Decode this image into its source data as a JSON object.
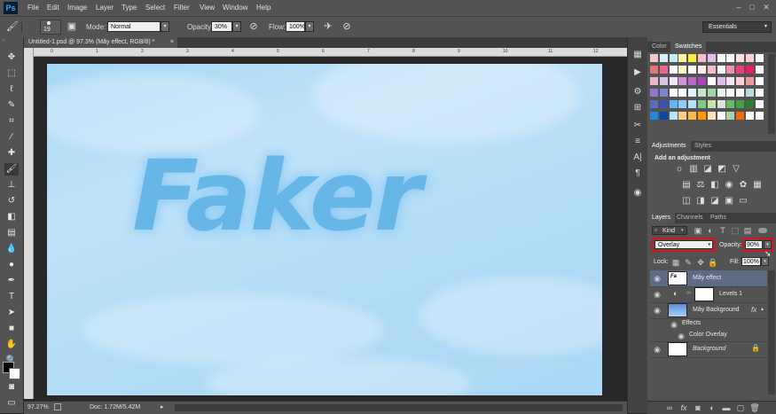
{
  "app": {
    "logo": "Ps"
  },
  "menu": [
    "File",
    "Edit",
    "Image",
    "Layer",
    "Type",
    "Select",
    "Filter",
    "View",
    "Window",
    "Help"
  ],
  "window_controls": {
    "minimize": "–",
    "maximize": "□",
    "close": "✕"
  },
  "options": {
    "brush_size": "19",
    "mode_label": "Mode:",
    "mode_value": "Normal",
    "opacity_label": "Opacity:",
    "opacity_value": "30%",
    "flow_label": "Flow:",
    "flow_value": "100%",
    "workspace": "Essentials"
  },
  "document": {
    "tab_title": "Untitled-1.psd @ 97.3% (Mây effect, RGB/8) *",
    "tab_close": "×",
    "canvas_text": "Faker",
    "ruler_top": [
      "0",
      "1",
      "2",
      "3",
      "4",
      "5",
      "6",
      "7",
      "8",
      "9",
      "10",
      "11",
      "12"
    ]
  },
  "status": {
    "zoom": "97.27%",
    "doc_size": "Doc: 1.72M/5.42M"
  },
  "panels": {
    "color_tabs": [
      "Color",
      "Swatches"
    ],
    "adjust_tabs": [
      "Adjustments",
      "Styles"
    ],
    "adjust_header": "Add an adjustment",
    "layers_tabs": [
      "Layers",
      "Channels",
      "Paths"
    ],
    "kind_label": "Kind",
    "blend_mode": "Overlay",
    "opacity_label": "Opacity:",
    "opacity_value": "90%",
    "lock_label": "Lock:",
    "fill_label": "Fill:",
    "fill_value": "100%",
    "layers": [
      {
        "name": "Mây effect",
        "fx": ""
      },
      {
        "name": "Levels 1",
        "fx": ""
      },
      {
        "name": "Mây Background",
        "fx": "fx"
      },
      {
        "name": "Effects",
        "fx": ""
      },
      {
        "name": "Color Overlay",
        "fx": ""
      },
      {
        "name": "Background",
        "fx": ""
      }
    ]
  },
  "swatch_colors": [
    [
      "#f5c6cb",
      "#d4f1f9",
      "#c2f0f0",
      "#fff59d",
      "#ffeb3b",
      "#f8bbd0",
      "#e1bee7",
      "#ffffff",
      "#ffffff",
      "#f8e0e6",
      "#ffcdd2",
      "#ffffff"
    ],
    [
      "#e57373",
      "#f06292",
      "#ffffff",
      "#fff9c4",
      "#ffffff",
      "#ffebee",
      "#f8bbd0",
      "#ffffff",
      "#f48fb1",
      "#ec407a",
      "#e91e63",
      "#ffffff"
    ],
    [
      "#e8b7c8",
      "#d1c4e9",
      "#f3e5f5",
      "#ce93d8",
      "#ba68c8",
      "#ab47bc",
      "#ffffff",
      "#e1bee7",
      "#f3e5f5",
      "#ffcdd2",
      "#ef9a9a",
      "#ffffff"
    ],
    [
      "#9575cd",
      "#7986cb",
      "#ffffff",
      "#ffffff",
      "#e3f2fd",
      "#c8e6c9",
      "#a5d6a7",
      "#e8f5e9",
      "#ffffff",
      "#ffffff",
      "#b2dfdb",
      "#ffffff"
    ],
    [
      "#5c6bc0",
      "#3f51b5",
      "#64b5f6",
      "#90caf9",
      "#bbdefb",
      "#81c784",
      "#c5e1a5",
      "#e0e0e0",
      "#66bb6a",
      "#43a047",
      "#2e7d32",
      "#ffffff"
    ],
    [
      "#1e88e5",
      "#0d47a1",
      "#b3e5fc",
      "#ffcc80",
      "#ffb74d",
      "#ff9800",
      "#ffe0b2",
      "#ffffff",
      "#a5d6a7",
      "#ef6c00",
      "#ffffff",
      "#ffffff"
    ]
  ]
}
